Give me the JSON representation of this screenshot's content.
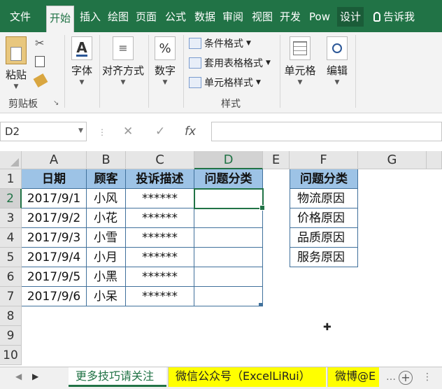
{
  "ribbon_tabs": [
    "文件",
    "开始",
    "插入",
    "绘图",
    "页面",
    "公式",
    "数据",
    "审阅",
    "视图",
    "开发",
    "Pow",
    "设计"
  ],
  "tell_me": "告诉我",
  "clipboard": {
    "paste": "粘贴",
    "group": "剪贴板"
  },
  "font": {
    "label": "字体"
  },
  "alignment": {
    "label": "对齐方式"
  },
  "number": {
    "label": "数字"
  },
  "styles": {
    "conditional": "条件格式",
    "table": "套用表格格式",
    "cell": "单元格样式",
    "group": "样式"
  },
  "cells": {
    "label": "单元格"
  },
  "editing": {
    "label": "编辑"
  },
  "formula_bar": {
    "name_box": "D2",
    "cancel": "✕",
    "enter": "✓",
    "fx": "fx",
    "content": ""
  },
  "columns": [
    "A",
    "B",
    "C",
    "D",
    "E",
    "F",
    "G"
  ],
  "rows": [
    "1",
    "2",
    "3",
    "4",
    "5",
    "6",
    "7",
    "8",
    "9",
    "10"
  ],
  "table": {
    "headers": [
      "日期",
      "顾客",
      "投诉描述",
      "问题分类"
    ],
    "rows": [
      [
        "2017/9/1",
        "小风",
        "******",
        ""
      ],
      [
        "2017/9/2",
        "小花",
        "******",
        ""
      ],
      [
        "2017/9/3",
        "小雪",
        "******",
        ""
      ],
      [
        "2017/9/4",
        "小月",
        "******",
        ""
      ],
      [
        "2017/9/5",
        "小黑",
        "******",
        ""
      ],
      [
        "2017/9/6",
        "小呆",
        "******",
        ""
      ]
    ]
  },
  "category_list": {
    "header": "问题分类",
    "items": [
      "物流原因",
      "价格原因",
      "品质原因",
      "服务原因"
    ]
  },
  "sheet_tabs": [
    "更多技巧请关注",
    "微信公众号（ExcelLiRui）",
    "微博@E"
  ],
  "colors": {
    "excel_green": "#217346",
    "table_header": "#9dc3e6",
    "highlight_tab": "#ffff00"
  }
}
